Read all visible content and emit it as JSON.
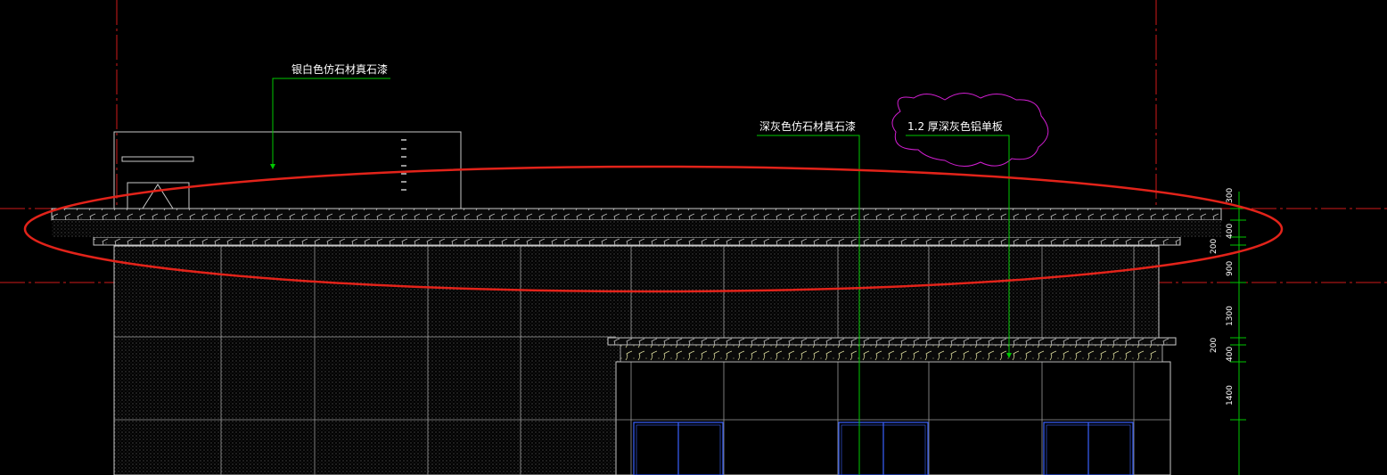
{
  "drawing": {
    "background": "#000000",
    "colors": {
      "outline": "#c8c8c8",
      "axis": "#d11a1a",
      "leader": "#00c800",
      "revision_cloud": "#d21ed2",
      "highlight": "#e2231a",
      "window": "#3a62ff",
      "hatch": "#6a6a6a",
      "text": "#ffffff"
    },
    "annotations": {
      "silver_stone": "银白色仿石材真石漆",
      "dark_grey_stone": "深灰色仿石材真石漆",
      "aluminum_panel": "1.2  厚深灰色铝单板"
    },
    "dimensions": [
      "300",
      "400",
      "200",
      "900",
      "1300",
      "200",
      "400",
      "1400"
    ]
  }
}
